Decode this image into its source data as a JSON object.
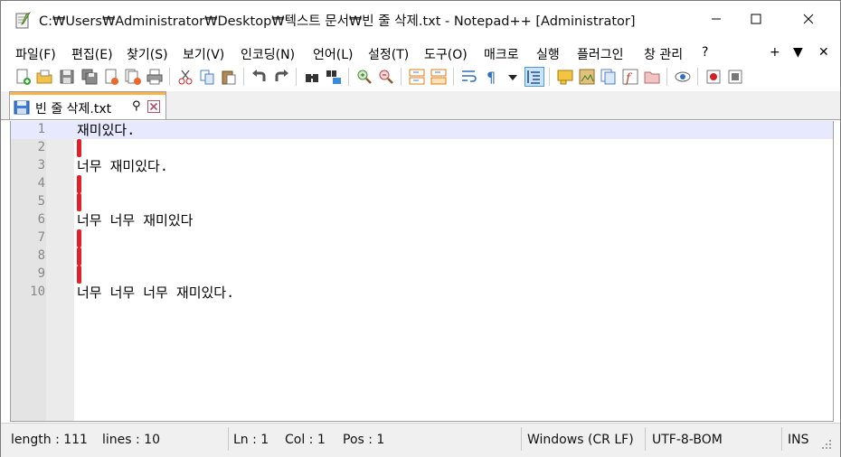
{
  "window": {
    "title": "C:₩Users₩Administrator₩Desktop₩텍스트 문서₩빈 줄 삭제.txt - Notepad++ [Administrator]"
  },
  "menu": {
    "items": [
      "파일(F)",
      "편집(E)",
      "찾기(S)",
      "보기(V)",
      "인코딩(N)",
      "언어(L)",
      "설정(T)",
      "도구(O)",
      "매크로",
      "실행",
      "플러그인",
      "창 관리",
      "?"
    ],
    "right": [
      "+",
      "▼",
      "✕"
    ]
  },
  "toolbar": {
    "icons": [
      "new-file-icon",
      "open-file-icon",
      "save-icon",
      "save-all-icon",
      "close-icon",
      "close-all-icon",
      "print-icon",
      "cut-icon",
      "copy-icon",
      "paste-icon",
      "undo-icon",
      "redo-icon",
      "find-icon",
      "replace-icon",
      "zoom-in-icon",
      "zoom-out-icon",
      "sync-vertical-icon",
      "sync-horizontal-icon",
      "word-wrap-icon",
      "show-all-chars-icon",
      "indent-guide-icon",
      "udl-icon",
      "doc-map-icon",
      "doc-list-icon",
      "function-list-icon",
      "folder-workspace-icon",
      "monitoring-icon",
      "record-macro-icon",
      "stop-macro-icon"
    ]
  },
  "tab": {
    "label": "빈 줄 삭제.txt",
    "pin": "⚲",
    "accent": "#fab347"
  },
  "editor": {
    "lines": [
      {
        "num": "1",
        "text": "재미있다.",
        "marker": false,
        "current": true
      },
      {
        "num": "2",
        "text": "",
        "marker": true,
        "current": false
      },
      {
        "num": "3",
        "text": "너무 재미있다.",
        "marker": false,
        "current": false
      },
      {
        "num": "4",
        "text": "",
        "marker": true,
        "current": false
      },
      {
        "num": "5",
        "text": "",
        "marker": true,
        "current": false
      },
      {
        "num": "6",
        "text": "너무 너무 재미있다",
        "marker": false,
        "current": false
      },
      {
        "num": "7",
        "text": "",
        "marker": true,
        "current": false
      },
      {
        "num": "8",
        "text": "",
        "marker": true,
        "current": false
      },
      {
        "num": "9",
        "text": "",
        "marker": true,
        "current": false
      },
      {
        "num": "10",
        "text": "너무 너무 너무 재미있다.",
        "marker": false,
        "current": false
      }
    ],
    "marker_color": "#e2202a",
    "current_line_color": "#e8e8ff"
  },
  "status": {
    "length": "length : 111",
    "lines": "lines : 10",
    "ln": "Ln : 1",
    "col": "Col : 1",
    "pos": "Pos : 1",
    "eol": "Windows (CR LF)",
    "encoding": "UTF-8-BOM",
    "mode": "INS"
  }
}
